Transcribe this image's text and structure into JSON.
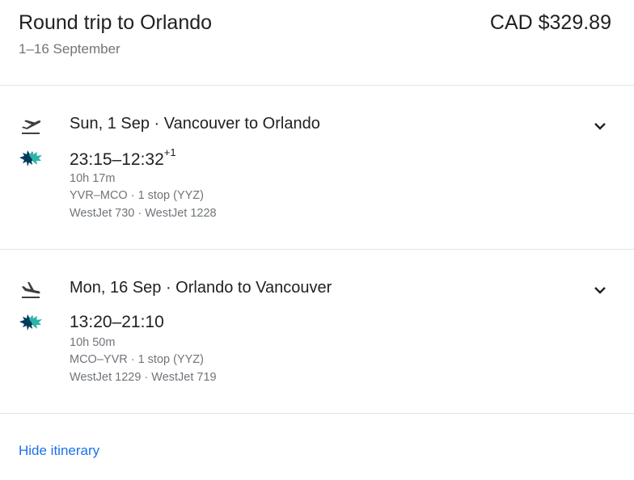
{
  "header": {
    "title": "Round trip to Orlando",
    "dates": "1–16 September",
    "price": "CAD $329.89"
  },
  "legs": [
    {
      "direction_icon": "takeoff-icon",
      "airline_icon": "westjet-logo-icon",
      "title": "Sun, 1 Sep · Vancouver to Orlando",
      "times": "23:15–12:32",
      "day_offset": "+1",
      "duration": "10h 17m",
      "route": "YVR–MCO · 1 stop (YYZ)",
      "flights": "WestJet 730 · WestJet 1228"
    },
    {
      "direction_icon": "landing-icon",
      "airline_icon": "westjet-logo-icon",
      "title": "Mon, 16 Sep · Orlando to Vancouver",
      "times": "13:20–21:10",
      "day_offset": "",
      "duration": "10h 50m",
      "route": "MCO–YVR · 1 stop (YYZ)",
      "flights": "WestJet 1229 · WestJet 719"
    }
  ],
  "footer": {
    "hide_label": "Hide itinerary"
  },
  "colors": {
    "text": "#202124",
    "muted": "#70757a",
    "link": "#1a73e8",
    "divider": "#e4e4e4",
    "westjet_teal": "#0a9fa4",
    "westjet_navy": "#003a5d"
  }
}
